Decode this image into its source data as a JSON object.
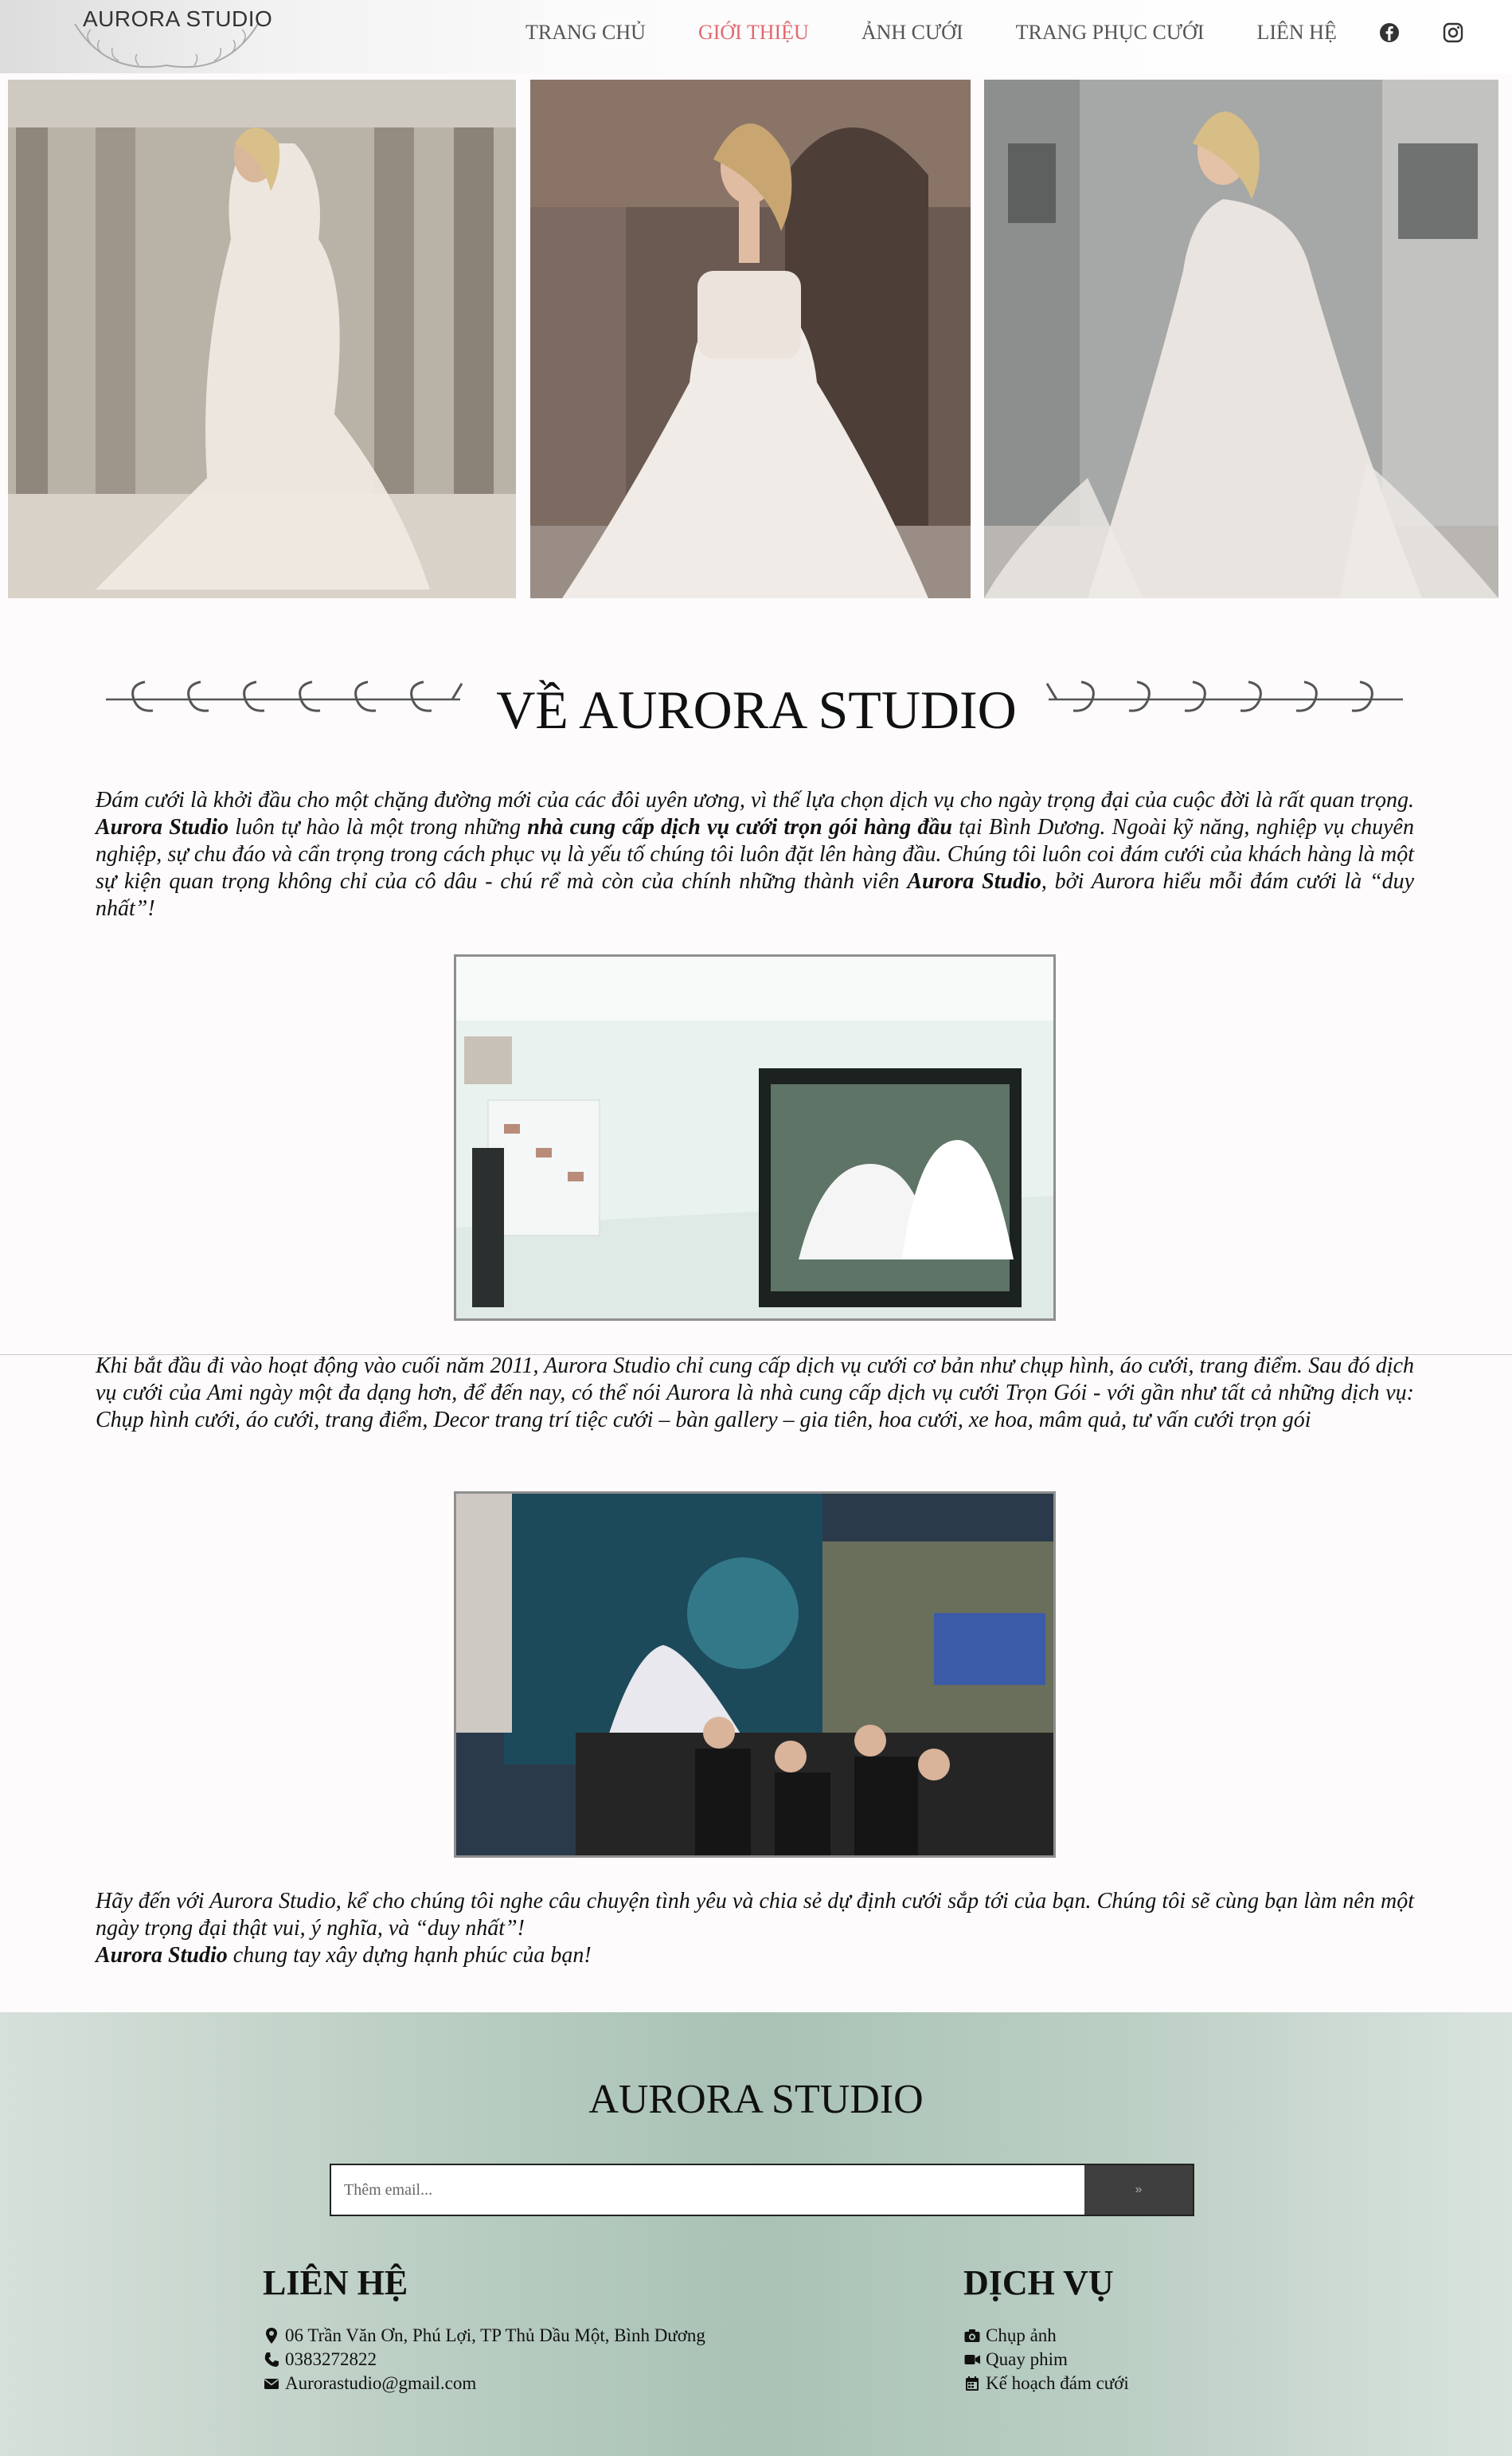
{
  "header": {
    "logo_text": "AURORA STUDIO",
    "nav": [
      {
        "label": "TRANG CHỦ",
        "active": false
      },
      {
        "label": "GIỚI THIỆU",
        "active": true
      },
      {
        "label": "ẢNH CƯỚI",
        "active": false
      },
      {
        "label": "TRANG PHỤC CƯỚI",
        "active": false
      },
      {
        "label": "LIÊN HỆ",
        "active": false
      }
    ],
    "social_icons": [
      "facebook-icon",
      "instagram-icon"
    ]
  },
  "about": {
    "title": "VỀ AURORA STUDIO",
    "p1": {
      "t1": "Đám cưới là khởi đầu cho một chặng đường mới của các đôi uyên ương, vì thế lựa chọn dịch vụ cho ngày trọng đại của cuộc đời là rất quan trọng. ",
      "b1": "Aurora Studio",
      "t2": " luôn tự hào là một trong những ",
      "b2": "nhà cung cấp dịch vụ cưới trọn gói hàng đầu",
      "t3": " tại Bình Dương. Ngoài kỹ năng, nghiệp vụ chuyên nghiệp, sự chu đáo và cẩn trọng trong cách phục vụ là yếu tố chúng tôi luôn đặt lên hàng đầu. Chúng tôi luôn coi đám cưới của khách hàng là một sự kiện quan trọng không chỉ của cô dâu - chú rể mà còn của chính những thành viên ",
      "b3": "Aurora Studio",
      "t4": ", bởi Aurora hiểu mỗi đám cưới là “duy nhất”!"
    },
    "p2": "Khi bắt đầu đi vào hoạt động vào cuối năm 2011, Aurora Studio chỉ cung cấp dịch vụ cưới cơ bản như chụp hình, áo cưới, trang điểm. Sau đó dịch vụ cưới của Ami ngày một đa dạng hơn, để đến nay, có thể nói Aurora là nhà cung cấp dịch vụ cưới Trọn Gói - với gần như tất cả những dịch vụ: Chụp hình cưới, áo cưới, trang điểm, Decor trang trí tiệc cưới – bàn gallery – gia tiên, hoa cưới, xe hoa, mâm quả, tư vấn cưới trọn gói",
    "p3": {
      "t1": "Hãy đến với Aurora Studio, kể cho chúng tôi nghe câu chuyện tình yêu và chia sẻ dự định cưới sắp tới của bạn. Chúng tôi sẽ cùng bạn làm nên một ngày trọng đại thật vui, ý nghĩa, và “duy nhất”!",
      "b1": "Aurora Studio",
      "t2": " chung tay xây dựng hạnh phúc của bạn!"
    }
  },
  "footer": {
    "title": "AURORA STUDIO",
    "email_placeholder": "Thêm email...",
    "submit_label": "»",
    "contact": {
      "heading": "LIÊN HỆ",
      "address": "06 Trần Văn Ơn, Phú Lợi, TP Thủ Dầu Một, Bình Dương",
      "phone": "0383272822",
      "email": "Aurorastudio@gmail.com"
    },
    "services": {
      "heading": "DỊCH VỤ",
      "items": [
        "Chụp ảnh",
        "Quay phim",
        "Kế hoạch đám cưới"
      ]
    }
  },
  "colors": {
    "nav_active": "#e0696f",
    "footer_bg": "#a9c2b5"
  }
}
